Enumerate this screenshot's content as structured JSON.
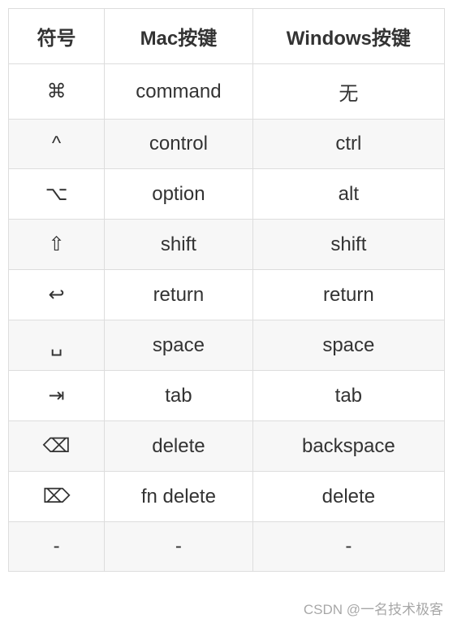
{
  "headers": {
    "symbol": "符号",
    "mac": "Mac按键",
    "windows": "Windows按键"
  },
  "rows": [
    {
      "symbol": "⌘",
      "mac": "command",
      "windows": "无"
    },
    {
      "symbol": "^",
      "mac": "control",
      "windows": "ctrl"
    },
    {
      "symbol": "⌥",
      "mac": "option",
      "windows": "alt"
    },
    {
      "symbol": "⇧",
      "mac": "shift",
      "windows": "shift"
    },
    {
      "symbol": "↩",
      "mac": "return",
      "windows": "return"
    },
    {
      "symbol": "␣",
      "mac": "space",
      "windows": "space"
    },
    {
      "symbol": "⇥",
      "mac": "tab",
      "windows": "tab"
    },
    {
      "symbol": "⌫",
      "mac": "delete",
      "windows": "backspace"
    },
    {
      "symbol": "⌦",
      "mac": "fn delete",
      "windows": "delete"
    },
    {
      "symbol": "-",
      "mac": "-",
      "windows": "-"
    }
  ],
  "watermark": "CSDN @一名技术极客"
}
